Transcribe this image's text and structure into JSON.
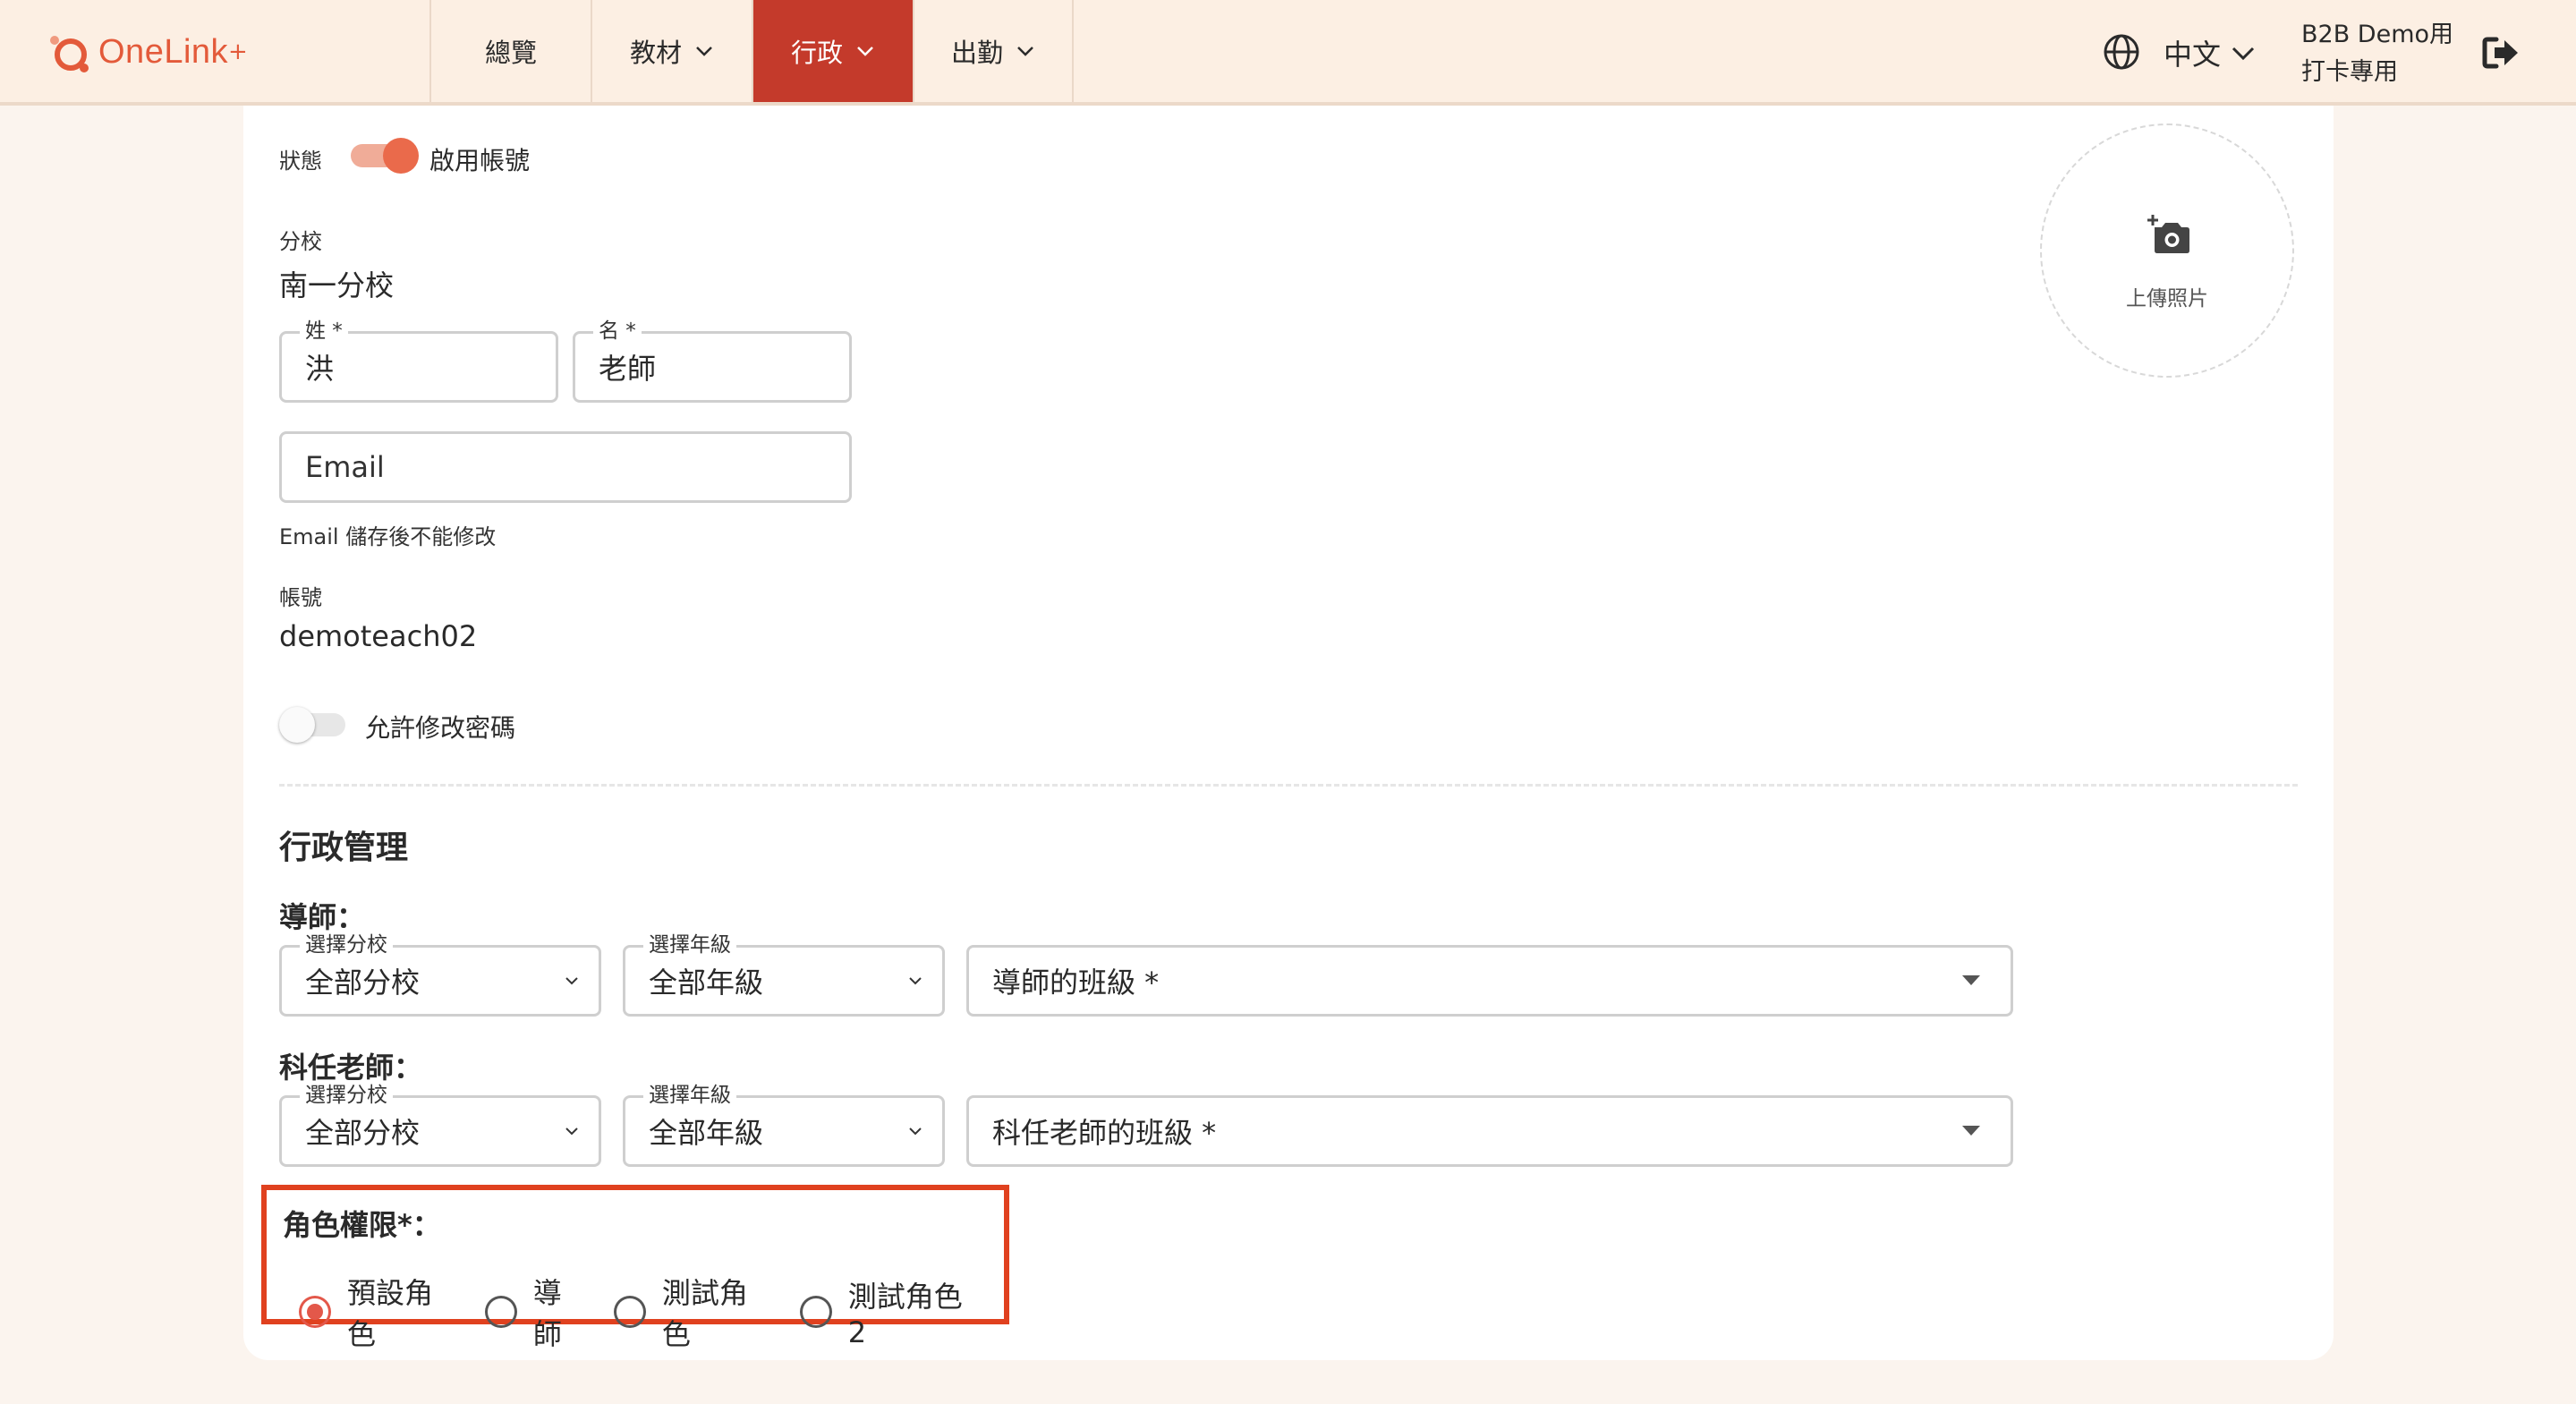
{
  "header": {
    "logo_text": "OneLink",
    "logo_plus": "+",
    "nav": [
      {
        "label": "總覽",
        "dropdown": false,
        "active": false
      },
      {
        "label": "教材",
        "dropdown": true,
        "active": false
      },
      {
        "label": "行政",
        "dropdown": true,
        "active": true
      },
      {
        "label": "出勤",
        "dropdown": true,
        "active": false
      }
    ],
    "language": "中文",
    "user_line1": "B2B Demo用",
    "user_line2": "打卡專用"
  },
  "form": {
    "status_label": "狀態",
    "status_toggle_label": "啟用帳號",
    "status_enabled": true,
    "branch_label": "分校",
    "branch_value": "南一分校",
    "last_name_legend": "姓 *",
    "last_name_value": "洪",
    "first_name_legend": "名 *",
    "first_name_value": "老師",
    "email_placeholder": "Email",
    "email_hint": "Email 儲存後不能修改",
    "account_label": "帳號",
    "account_value": "demoteach02",
    "allow_password_label": "允許修改密碼",
    "allow_password_enabled": false,
    "upload_label": "上傳照片"
  },
  "admin": {
    "section_title": "行政管理",
    "tutor": {
      "title": "導師：",
      "branch_legend": "選擇分校",
      "branch_value": "全部分校",
      "grade_legend": "選擇年級",
      "grade_value": "全部年級",
      "class_placeholder": "導師的班級 *"
    },
    "subject_teacher": {
      "title": "科任老師：",
      "branch_legend": "選擇分校",
      "branch_value": "全部分校",
      "grade_legend": "選擇年級",
      "grade_value": "全部年級",
      "class_placeholder": "科任老師的班級 *"
    },
    "roles": {
      "title": "角色權限*：",
      "options": [
        "預設角色",
        "導師",
        "測試角色",
        "測試角色2"
      ],
      "selected": "預設角色"
    }
  },
  "colors": {
    "accent": "#e35a3a",
    "nav_active": "#c43a2b",
    "header_bg": "#fcefe3",
    "highlight_box": "#e0411f"
  }
}
